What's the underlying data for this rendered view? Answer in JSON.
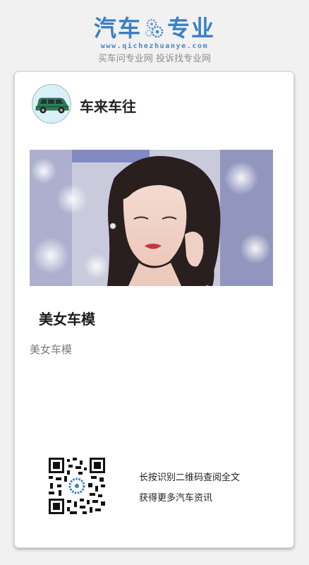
{
  "header": {
    "logo_left": "汽车",
    "logo_right": "专业",
    "logo_url": "www.qichezhuanye.com",
    "tagline": "买车问专业网 投诉找专业网"
  },
  "card": {
    "author_name": "车来车往",
    "title": "美女车模",
    "description": "美女车模",
    "qr_caption_1": "长按识别二维码查阅全文",
    "qr_caption_2": "获得更多汽车资讯"
  },
  "colors": {
    "brand_blue": "#3a7fc1",
    "avatar_bg": "#d7f1f7",
    "car_green": "#2f7f56"
  },
  "icons": {
    "logo_gear": "gear-cluster-icon",
    "avatar": "green-car-icon",
    "qr": "qr-code"
  }
}
